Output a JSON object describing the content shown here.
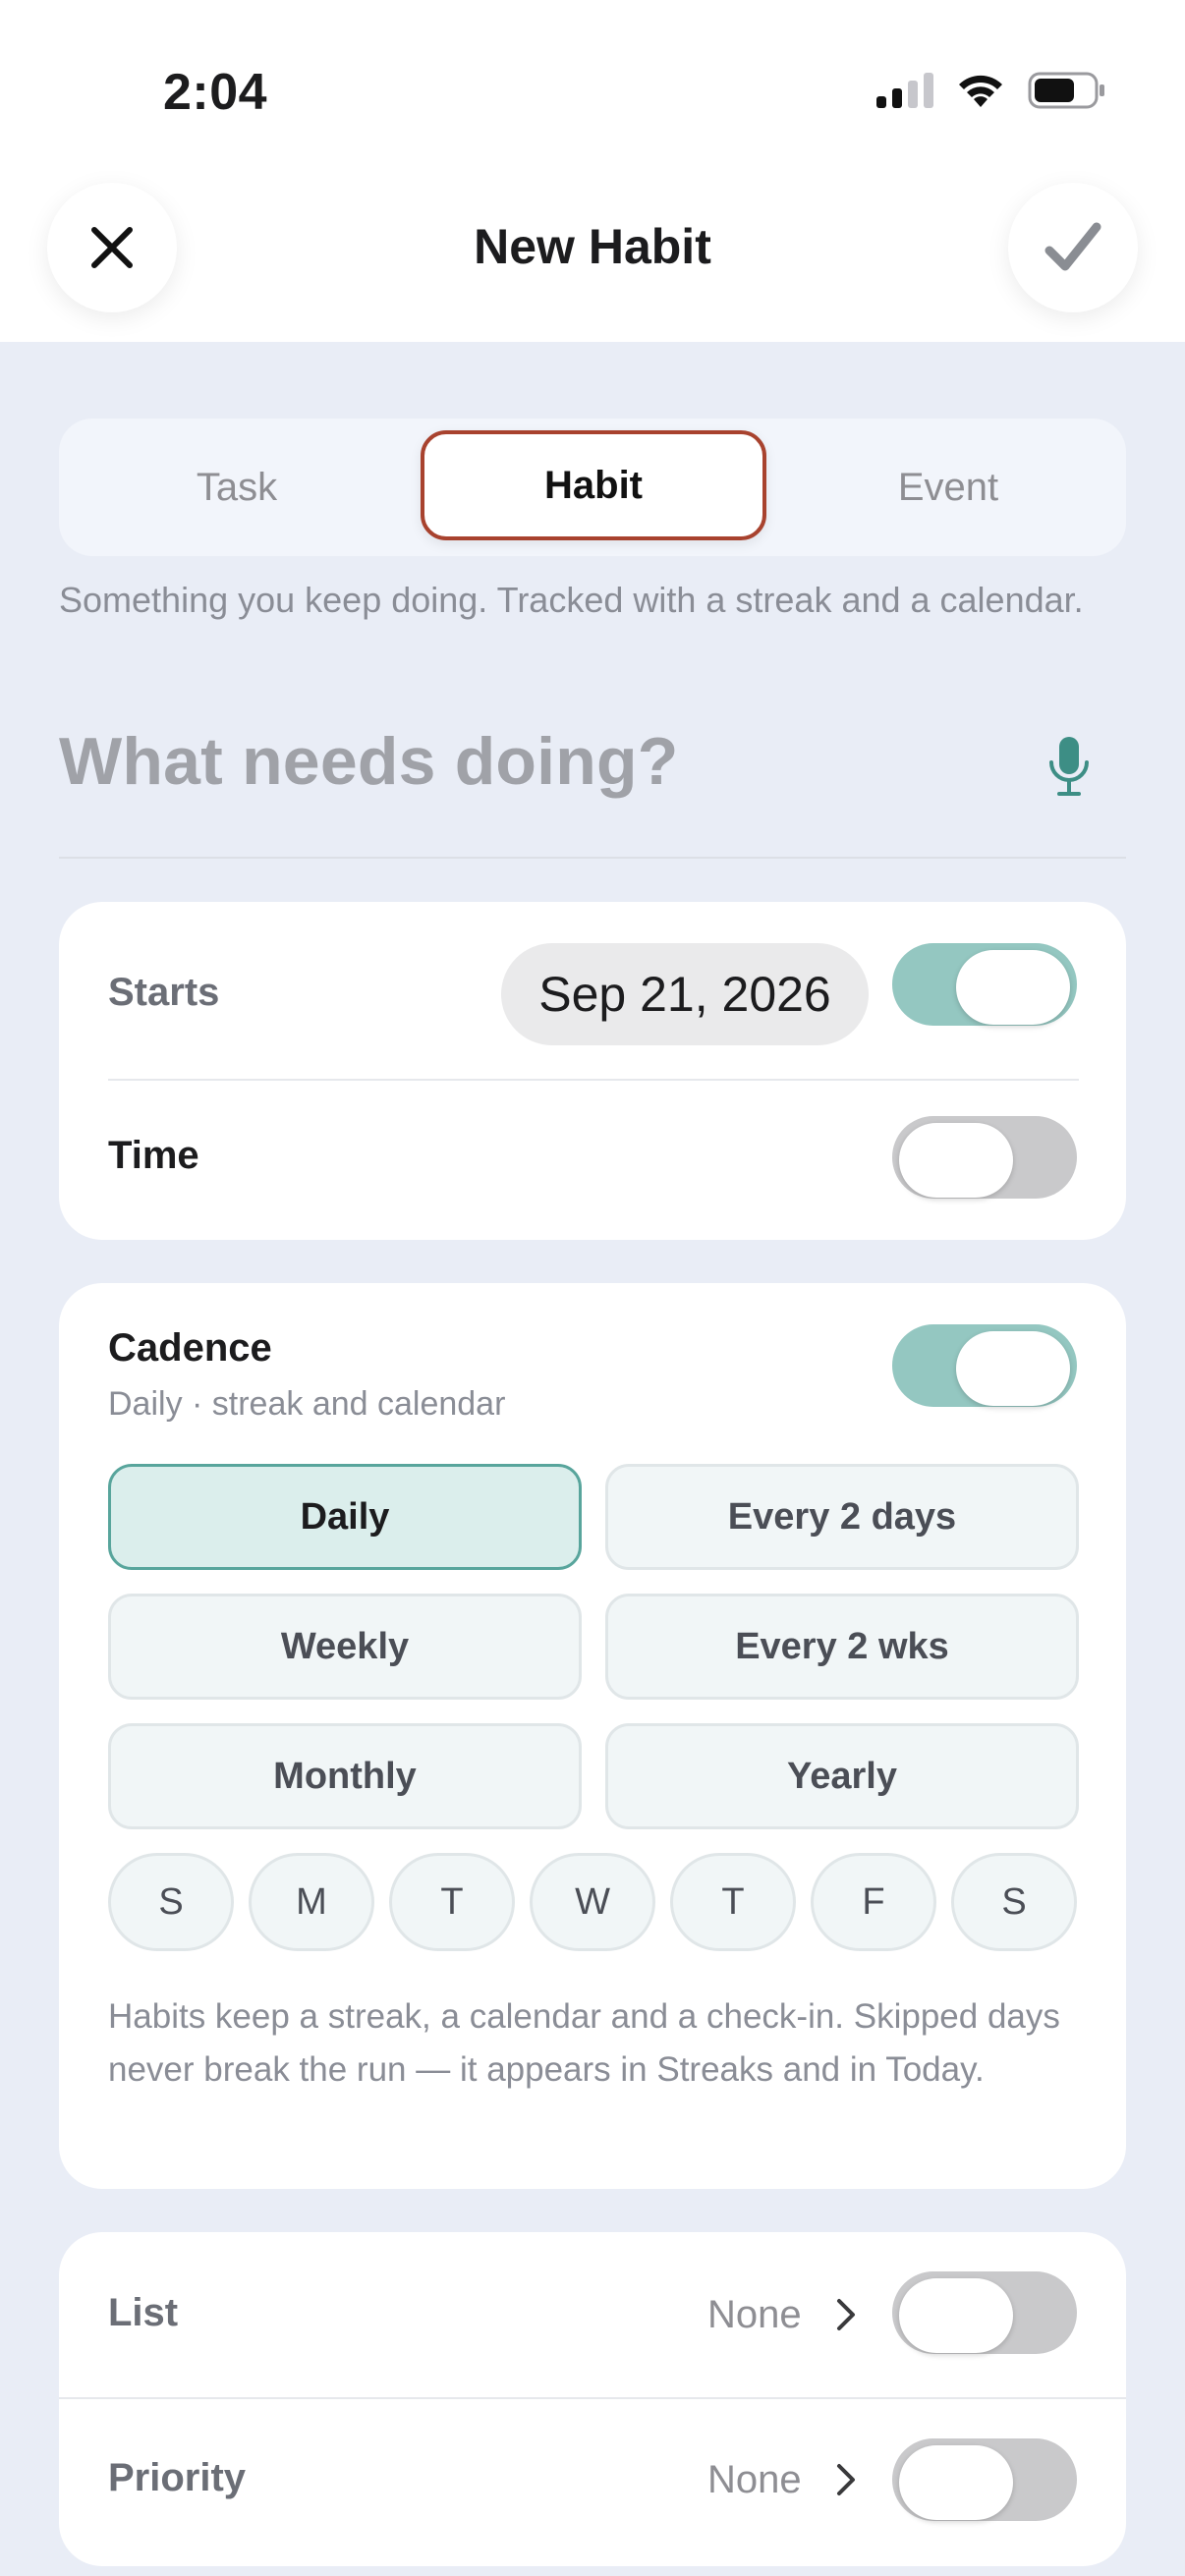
{
  "status": {
    "time": "2:04"
  },
  "nav": {
    "title": "New Habit",
    "close_icon": "close-icon",
    "confirm_icon": "checkmark-icon"
  },
  "segments": {
    "items": [
      "Task",
      "Habit",
      "Event"
    ],
    "selected": "Habit"
  },
  "description": "Something you keep doing. Tracked with a streak and a calendar.",
  "title_input": {
    "placeholder": "What needs doing?",
    "value": ""
  },
  "schedule": {
    "starts_label": "Starts",
    "starts_value": "Sep 21, 2026",
    "starts_enabled": true,
    "time_label": "Time",
    "time_enabled": false
  },
  "cadence": {
    "label": "Cadence",
    "subtitle": "Daily · streak and calendar",
    "enabled": true,
    "options": [
      "Daily",
      "Every 2 days",
      "Weekly",
      "Every 2 wks",
      "Monthly",
      "Yearly"
    ],
    "selected": "Daily",
    "days": [
      "S",
      "M",
      "T",
      "W",
      "T",
      "F",
      "S"
    ],
    "note": "Habits keep a streak, a calendar and a check-in. Skipped days never break the run — it appears in Streaks and in Today."
  },
  "details": {
    "list_label": "List",
    "list_value": "None",
    "list_enabled": false,
    "priority_label": "Priority",
    "priority_value": "None",
    "priority_enabled": false
  },
  "colors": {
    "accent": "#94c7c1",
    "selected_border": "#a8422e",
    "teal": "#3d8e85"
  }
}
